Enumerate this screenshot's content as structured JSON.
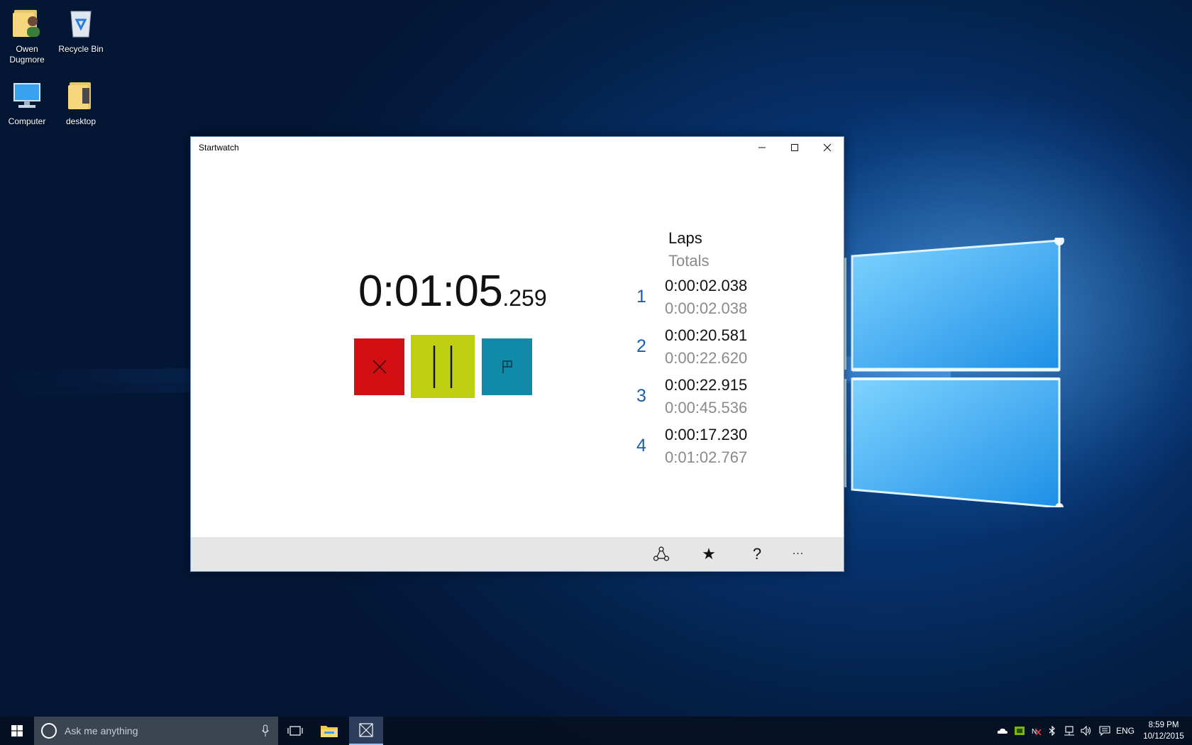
{
  "desktop": {
    "icons": [
      {
        "label": "Owen\nDugmore",
        "icon": "user-folder-icon"
      },
      {
        "label": "Recycle Bin",
        "icon": "recycle-bin-icon"
      },
      {
        "label": "Computer",
        "icon": "computer-icon"
      },
      {
        "label": "desktop",
        "icon": "folder-icon"
      }
    ]
  },
  "window": {
    "title": "Startwatch",
    "controls": {
      "minimize": "minimize-icon",
      "maximize": "maximize-icon",
      "close": "close-icon"
    }
  },
  "stopwatch": {
    "main": "0:01:05",
    "fraction": ".259",
    "buttons": {
      "reset": {
        "icon": "x-icon",
        "color": "#d20f12"
      },
      "pause": {
        "icon": "pause-icon",
        "color": "#bfd012"
      },
      "lap": {
        "icon": "flag-icon",
        "color": "#1189a8"
      }
    }
  },
  "laps": {
    "heading": "Laps",
    "subheading": "Totals",
    "items": [
      {
        "num": "1",
        "lap": "0:00:02.038",
        "total": "0:00:02.038"
      },
      {
        "num": "2",
        "lap": "0:00:20.581",
        "total": "0:00:22.620"
      },
      {
        "num": "3",
        "lap": "0:00:22.915",
        "total": "0:00:45.536"
      },
      {
        "num": "4",
        "lap": "0:00:17.230",
        "total": "0:01:02.767"
      }
    ]
  },
  "appbar": {
    "share": "share-icon",
    "favorite": "★",
    "help": "?",
    "more": "···"
  },
  "taskbar": {
    "search_placeholder": "Ask me anything",
    "tray_language": "ENG",
    "time": "8:59 PM",
    "date": "10/12/2015"
  },
  "colors": {
    "lap_number": "#1a5fa8",
    "total_text": "#8a8a8a",
    "appbar_bg": "#e6e6e6"
  }
}
